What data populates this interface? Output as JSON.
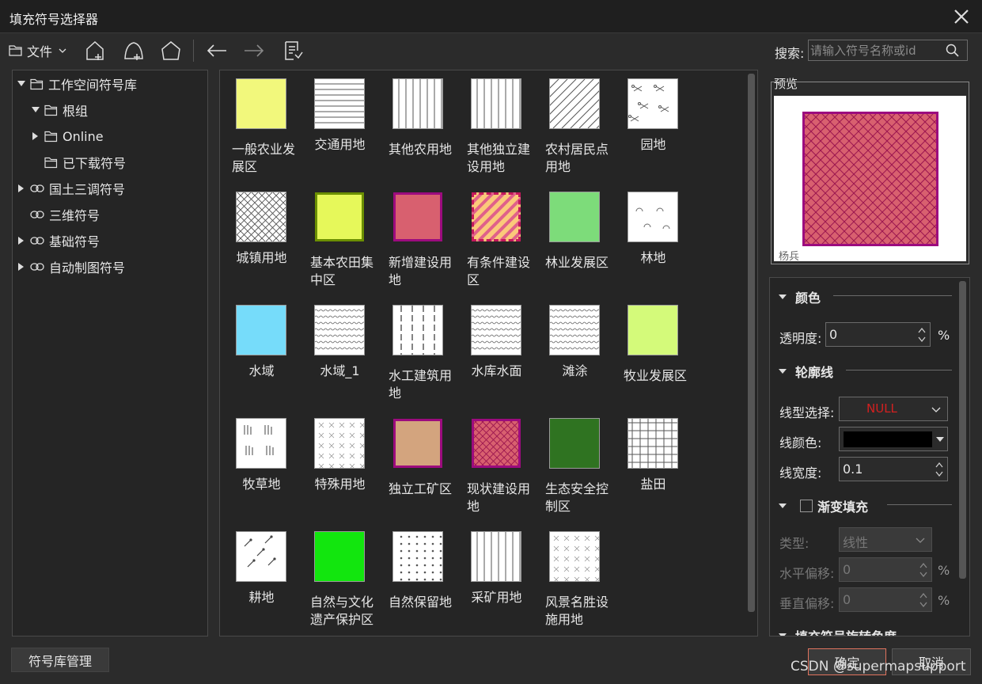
{
  "window": {
    "title": "填充符号选择器"
  },
  "toolbar": {
    "file_label": "文件",
    "search_label": "搜索:",
    "search_placeholder": "请输入符号名称或id"
  },
  "tree": [
    {
      "label": "工作空间符号库",
      "indent": 0,
      "expanded": true,
      "icon": "folder-icon"
    },
    {
      "label": "根组",
      "indent": 1,
      "expanded": true,
      "icon": "folder-icon"
    },
    {
      "label": "Online",
      "indent": 1,
      "expanded": false,
      "icon": "folder-icon"
    },
    {
      "label": "已下载符号",
      "indent": 1,
      "expanded": null,
      "icon": "folder-icon"
    },
    {
      "label": "国土三调符号",
      "indent": 0,
      "expanded": false,
      "icon": "link-icon"
    },
    {
      "label": "三维符号",
      "indent": 0,
      "expanded": null,
      "icon": "link-icon"
    },
    {
      "label": "基础符号",
      "indent": 0,
      "expanded": false,
      "icon": "link-icon"
    },
    {
      "label": "自动制图符号",
      "indent": 0,
      "expanded": false,
      "icon": "link-icon"
    }
  ],
  "symbols": [
    {
      "label": "一般农业发展区",
      "fill": "#f2f87c",
      "pattern": "solid",
      "border": "none"
    },
    {
      "label": "交通用地",
      "fill": "#ffffff",
      "pattern": "hlines",
      "border": "none"
    },
    {
      "label": "其他农用地",
      "fill": "#ffffff",
      "pattern": "vlines",
      "border": "none"
    },
    {
      "label": "其他独立建设用地",
      "fill": "#ffffff",
      "pattern": "vlines",
      "border": "none"
    },
    {
      "label": "农村居民点用地",
      "fill": "#ffffff",
      "pattern": "diag",
      "border": "none"
    },
    {
      "label": "园地",
      "fill": "#ffffff",
      "pattern": "scissors",
      "border": "none"
    },
    {
      "label": "城镇用地",
      "fill": "#ffffff",
      "pattern": "cross",
      "border": "none"
    },
    {
      "label": "基本农田集中区",
      "fill": "#e6f85a",
      "pattern": "solid",
      "border": "#6b8f00"
    },
    {
      "label": "新增建设用地",
      "fill": "#d8606f",
      "pattern": "solid",
      "border": "#9c0b7e"
    },
    {
      "label": "有条件建设区",
      "fill": "#fbc97a",
      "pattern": "diag-pink",
      "border": "#c2185b"
    },
    {
      "label": "林业发展区",
      "fill": "#7ddc7a",
      "pattern": "solid",
      "border": "none"
    },
    {
      "label": "林地",
      "fill": "#ffffff",
      "pattern": "arcs",
      "border": "none"
    },
    {
      "label": "水域",
      "fill": "#76dcfa",
      "pattern": "solid",
      "border": "none"
    },
    {
      "label": "水域_1",
      "fill": "#ffffff",
      "pattern": "waves",
      "border": "none"
    },
    {
      "label": "水工建筑用地",
      "fill": "#ffffff",
      "pattern": "dashv",
      "border": "none"
    },
    {
      "label": "水库水面",
      "fill": "#ffffff",
      "pattern": "waves",
      "border": "none"
    },
    {
      "label": "滩涂",
      "fill": "#ffffff",
      "pattern": "waves",
      "border": "none"
    },
    {
      "label": "牧业发展区",
      "fill": "#d4fa7a",
      "pattern": "solid",
      "border": "none"
    },
    {
      "label": "牧草地",
      "fill": "#ffffff",
      "pattern": "grass",
      "border": "none"
    },
    {
      "label": "特殊用地",
      "fill": "#ffffff",
      "pattern": "xs",
      "border": "none"
    },
    {
      "label": "独立工矿区",
      "fill": "#d3a47e",
      "pattern": "solid",
      "border": "#9c0b7e"
    },
    {
      "label": "现状建设用地",
      "fill": "#d8606f",
      "pattern": "cross-pink",
      "border": "#9c0b7e"
    },
    {
      "label": "生态安全控制区",
      "fill": "#2f7321",
      "pattern": "solid",
      "border": "none"
    },
    {
      "label": "盐田",
      "fill": "#ffffff",
      "pattern": "grid",
      "border": "none"
    },
    {
      "label": "耕地",
      "fill": "#ffffff",
      "pattern": "leaf",
      "border": "none"
    },
    {
      "label": "自然与文化遗产保护区",
      "fill": "#12e60e",
      "pattern": "solid",
      "border": "none"
    },
    {
      "label": "自然保留地",
      "fill": "#ffffff",
      "pattern": "dots",
      "border": "none"
    },
    {
      "label": "采矿用地",
      "fill": "#ffffff",
      "pattern": "vlines",
      "border": "none"
    },
    {
      "label": "风景名胜设施用地",
      "fill": "#ffffff",
      "pattern": "xs",
      "border": "none"
    }
  ],
  "preview": {
    "title": "预览",
    "author": "杨兵",
    "fill": "#d8606f",
    "border": "#9c0b7e"
  },
  "props": {
    "color_section": "颜色",
    "transparency_label": "透明度:",
    "transparency_value": "0",
    "percent": "%",
    "outline_section": "轮廓线",
    "line_type_label": "线型选择:",
    "line_type_value": "NULL",
    "line_color_label": "线颜色:",
    "line_color_value": "#000000",
    "line_width_label": "线宽度:",
    "line_width_value": "0.1",
    "gradient_section": "渐变填充",
    "type_label": "类型:",
    "type_value": "线性",
    "hoffset_label": "水平偏移:",
    "hoffset_value": "0",
    "voffset_label": "垂直偏移:",
    "voffset_value": "0",
    "rotation_section": "填充符号旋转角度"
  },
  "footer": {
    "manage_label": "符号库管理",
    "ok_label": "确定",
    "cancel_label": "取消",
    "watermark": "CSDN @supermapsupport"
  }
}
